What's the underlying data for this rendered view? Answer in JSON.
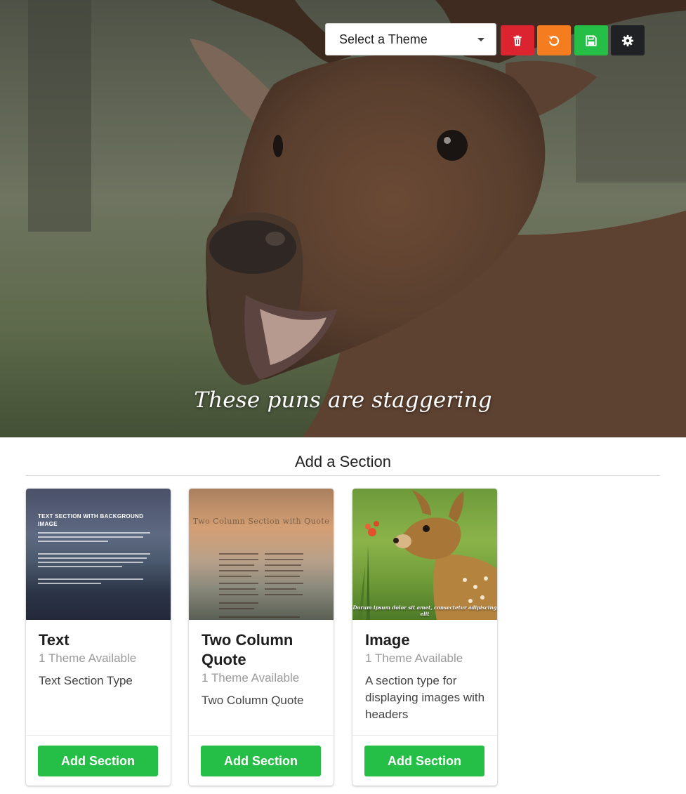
{
  "hero": {
    "caption": "These puns are staggering"
  },
  "toolbar": {
    "theme_select_label": "Select a Theme",
    "buttons": [
      {
        "name": "delete",
        "icon": "trash-icon",
        "color": "#dc2430"
      },
      {
        "name": "reset",
        "icon": "undo-icon",
        "color": "#f57c1f"
      },
      {
        "name": "save",
        "icon": "floppy-disk-icon",
        "color": "#25bf47"
      },
      {
        "name": "settings",
        "icon": "gear-icon",
        "color": "#1f2124"
      }
    ]
  },
  "add_section": {
    "heading": "Add a Section",
    "cards": [
      {
        "title": "Text",
        "count": "1 Theme Available",
        "description": "Text Section Type",
        "button_label": "Add Section",
        "thumb_heading": "TEXT SECTION WITH BACKGROUND IMAGE"
      },
      {
        "title": "Two Column Quote",
        "count": "1 Theme Available",
        "description": "Two Column Quote",
        "button_label": "Add Section",
        "thumb_heading": "Two Column Section with Quote"
      },
      {
        "title": "Image",
        "count": "1 Theme Available",
        "description": "A section type for displaying images with headers",
        "button_label": "Add Section",
        "thumb_caption": "Dorum ipsum dolor sit amet, consectetur adipiscing elit"
      }
    ]
  },
  "colors": {
    "accent_green": "#25bf47",
    "danger_red": "#dc2430",
    "warning_orange": "#f57c1f",
    "dark": "#1f2124"
  }
}
